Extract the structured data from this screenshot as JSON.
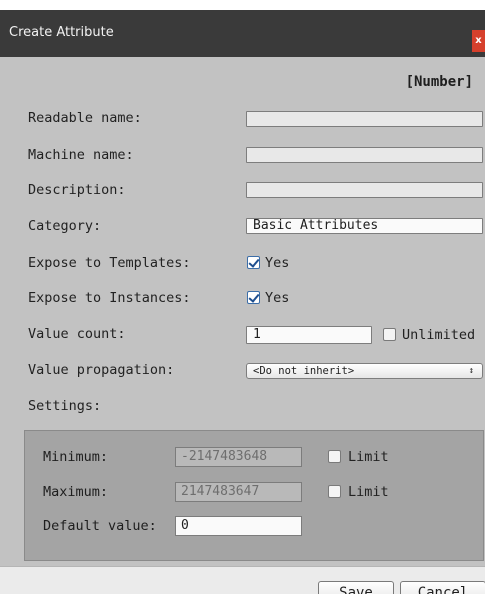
{
  "window": {
    "title": "Create Attribute",
    "close_label": "x"
  },
  "type_tag": "[Number]",
  "fields": {
    "readable_name": {
      "label": "Readable name:",
      "value": ""
    },
    "machine_name": {
      "label": "Machine name:",
      "value": ""
    },
    "description": {
      "label": "Description:",
      "value": ""
    },
    "category": {
      "label": "Category:",
      "value": "Basic Attributes"
    },
    "expose_templates": {
      "label": "Expose to Templates:",
      "checked": true,
      "option_label": "Yes"
    },
    "expose_instances": {
      "label": "Expose to Instances:",
      "checked": true,
      "option_label": "Yes"
    },
    "value_count": {
      "label": "Value count:",
      "value": "1",
      "unlimited_label": "Unlimited",
      "unlimited_checked": false
    },
    "value_propagation": {
      "label": "Value propagation:",
      "selected": "<Do not inherit>"
    },
    "settings_label": "Settings:"
  },
  "settings": {
    "minimum": {
      "label": "Minimum:",
      "value": "-2147483648",
      "limit_label": "Limit",
      "limit_checked": false
    },
    "maximum": {
      "label": "Maximum:",
      "value": "2147483647",
      "limit_label": "Limit",
      "limit_checked": false
    },
    "default_value": {
      "label": "Default value:",
      "value": "0"
    }
  },
  "buttons": {
    "save": "Save",
    "cancel": "Cancel"
  },
  "colors": {
    "titlebar": "#3a3a3a",
    "close": "#d6402c",
    "panel": "#c2c2c2",
    "settings_box": "#a4a4a4"
  },
  "icons": {
    "checkmark": "checkmark-icon",
    "dropdown": "dropdown-arrows-icon",
    "close": "close-icon"
  }
}
